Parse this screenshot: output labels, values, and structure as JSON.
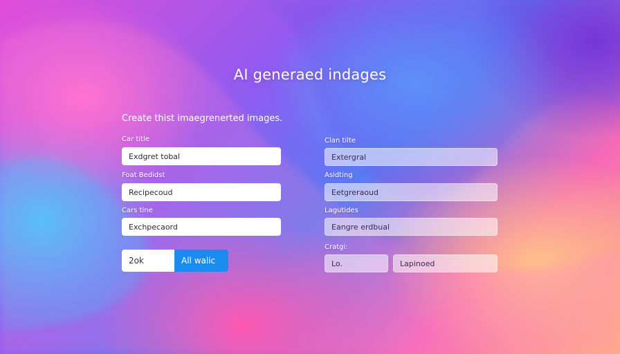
{
  "header": {
    "title": "AI generaed indages",
    "subtitle": "Create thist imaegrenerted images."
  },
  "left_form": {
    "fields": [
      {
        "label": "Car title",
        "value": "Exdgret tobal"
      },
      {
        "label": "Foat Bedidst",
        "value": "Recipecoud"
      },
      {
        "label": "Cars tine",
        "value": "Exchpecaord"
      }
    ],
    "actions": {
      "left_label": "2ok",
      "right_label": "All walic"
    }
  },
  "right_form": {
    "fields": [
      {
        "label": "Clan tilte",
        "value": "Extergral"
      },
      {
        "label": "Asidting",
        "value": "Eetgreraoud"
      },
      {
        "label": "Lagutides",
        "value": "Eangre erdbual"
      }
    ],
    "bottom": {
      "label": "Cratgi:",
      "small_value": "Lo.",
      "wide_value": "Lapinoed"
    }
  }
}
